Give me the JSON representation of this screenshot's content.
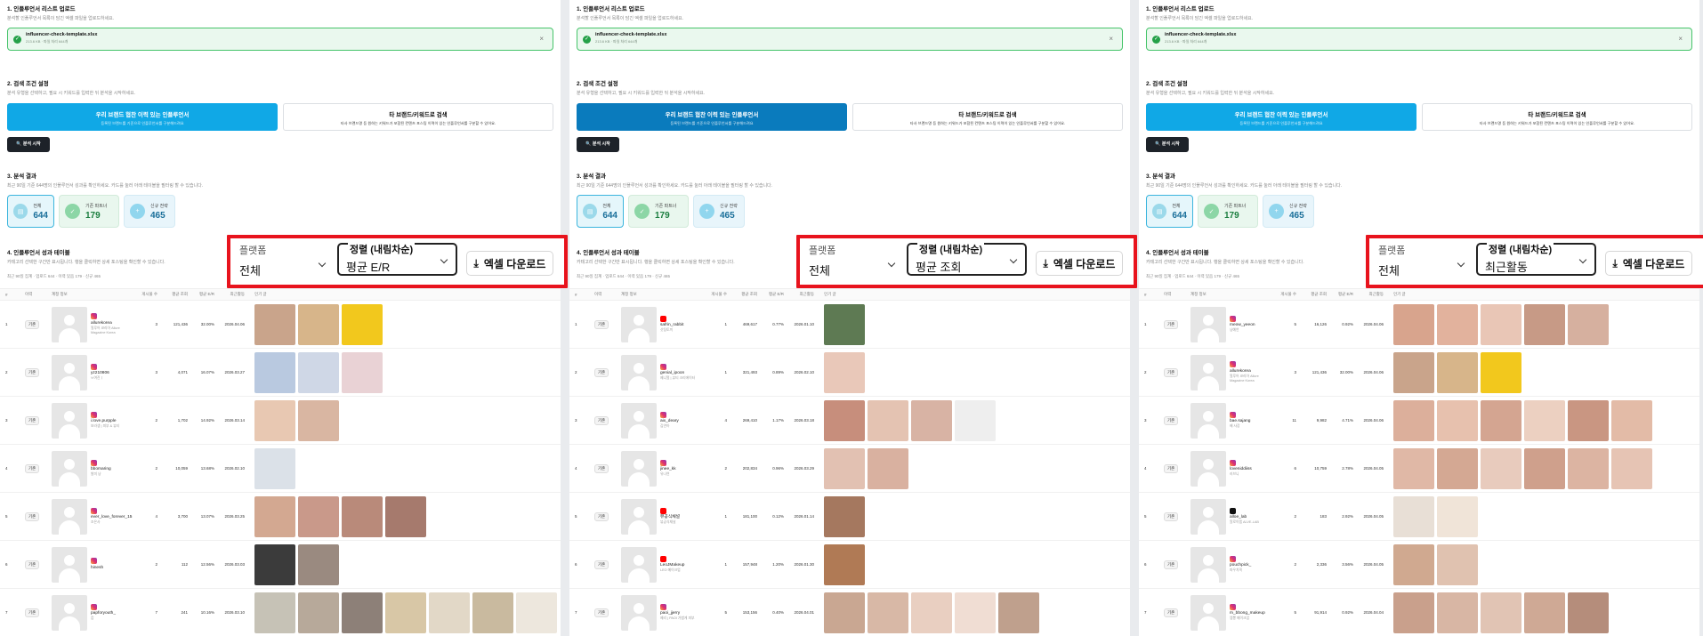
{
  "colors": {
    "accent": "#10a8e6",
    "highlight": "#e8131d",
    "success": "#24a148"
  },
  "panels": [
    {
      "s1": {
        "title": "1. 인플루언서 리스트 업로드",
        "desc": "분석할 인플루언서 목록이 담긴 엑셀 파일을 업로드하세요.",
        "file": "influencer-check-template.xlsx",
        "fileinfo": "213.6 KB · 파일 처리 644개"
      },
      "s2": {
        "title": "2. 검색 조건 설정",
        "desc": "분석 유형을 선택하고, 필요 시 키워드를 입력한 뒤 분석을 시작하세요.",
        "opt1": "우리 브랜드 협찬 이력 있는 인플루언서",
        "opt1s": "등록된 브랜드를 기준으로 인플루언서를 구분해드려요",
        "opt2": "타 브랜드/키워드로 검색",
        "opt2s": "타사 브랜드명 등 원하는 키워드가 포함된 컨텐츠 포스팅 이력이 있는 인플루언서를 구분할 수 있어요.",
        "run": "분석 시작"
      },
      "s3": {
        "title": "3. 분석 결과",
        "desc": "최근 90일 기준 644명의 인플루언서 성과를 확인하세요. 카드를 눌러 아래 테이블을 필터링 할 수 있습니다.",
        "all_label": "전체",
        "all": "644",
        "ex_label": "기존 파트너",
        "ex": "179",
        "new_label": "신규 전략",
        "new": "465"
      },
      "s4": {
        "title": "4. 인플루언서 성과 테이블",
        "desc": "카테고리 선택한 구간만 표시됩니다. 행을 클릭하면 상세 포스팅을 확인할 수 있습니다.",
        "meta": "최근 90일 집계 · 업로드 644 · 이력 있음 179 · 신규 465",
        "platform_label": "플랫폼",
        "platform": "전체",
        "sort_label": "정렬 (내림차순)",
        "sort": "평균 E/R",
        "download": "엑셀 다운로드"
      },
      "headers": [
        "#",
        "이력",
        "계정 정보",
        "게시물 수",
        "평균 조회",
        "평균 E/R",
        "최근활동",
        "인기 글"
      ],
      "rows": [
        {
          "no": "1",
          "tag": "기존",
          "pf": "ig",
          "name": "allurekorea",
          "sub": "얼루어 코리아 Allure Magazine Korea",
          "n": "3",
          "v": "121,436",
          "e": "32.00%",
          "d": "2026.04.06",
          "thumbs": [
            "#c9a48b",
            "#d7b58a",
            "#f2c81d"
          ]
        },
        {
          "no": "2",
          "tag": "기존",
          "pf": "ig",
          "name": "yz210806",
          "sub": "ㅂ여진ㅣ",
          "n": "3",
          "v": "4,071",
          "e": "16.07%",
          "d": "2026.03.27",
          "thumbs": [
            "#b9c9e0",
            "#cfd7e6",
            "#e9d2d5"
          ]
        },
        {
          "no": "3",
          "tag": "기존",
          "pf": "ig",
          "name": "i.love.purpple",
          "sub": "보라생 | 피부 & 뷰티",
          "n": "2",
          "v": "1,702",
          "e": "14.92%",
          "d": "2026.03.14",
          "thumbs": [
            "#e8c8b2",
            "#d9b6a2"
          ]
        },
        {
          "no": "4",
          "tag": "기존",
          "pf": "ig",
          "name": "bbomaring",
          "sub": "발미 냥",
          "n": "2",
          "v": "10,059",
          "e": "13.68%",
          "d": "2026.02.10",
          "thumbs": [
            "#dbe1e8"
          ]
        },
        {
          "no": "5",
          "tag": "기존",
          "pf": "ig",
          "name": "ever_love_forever_15",
          "sub": "조은사",
          "n": "4",
          "v": "3,700",
          "e": "13.07%",
          "d": "2026.03.25",
          "thumbs": [
            "#d3a891",
            "#c9998a",
            "#b98a7a",
            "#a67a6d"
          ]
        },
        {
          "no": "6",
          "tag": "기존",
          "pf": "ig",
          "name": "hinesh",
          "sub": "",
          "n": "2",
          "v": "112",
          "e": "12.56%",
          "d": "2026.03.03",
          "thumbs": [
            "#3b3b3b",
            "#9a8a80"
          ]
        },
        {
          "no": "7",
          "tag": "기존",
          "pf": "ig",
          "name": "papforyouth_",
          "sub": "캄",
          "n": "7",
          "v": "241",
          "e": "10.16%",
          "d": "2026.03.10",
          "thumbs": [
            "#c6c2b6",
            "#b7a99a",
            "#8d8078",
            "#d8c7a6",
            "#e2d8c7",
            "#c9ba9f",
            "#ede7dd"
          ]
        }
      ]
    },
    {
      "s1": {
        "title": "1. 인플루언서 리스트 업로드",
        "desc": "분석할 인플루언서 목록이 담긴 엑셀 파일을 업로드하세요.",
        "file": "influencer-check-template.xlsx",
        "fileinfo": "213.6 KB · 파일 처리 644개"
      },
      "s2": {
        "title": "2. 검색 조건 설정",
        "desc": "분석 유형을 선택하고, 필요 시 키워드를 입력한 뒤 분석을 시작하세요.",
        "opt1": "우리 브랜드 협찬 이력 있는 인플루언서",
        "opt1s": "등록된 브랜드를 기준으로 인플루언서를 구분해드려요",
        "opt2": "타 브랜드/키워드로 검색",
        "opt2s": "타사 브랜드명 등 원하는 키워드가 포함된 컨텐츠 포스팅 이력이 있는 인플루언서를 구분할 수 있어요.",
        "run": "분석 시작"
      },
      "s3": {
        "title": "3. 분석 결과",
        "desc": "최근 90일 기준 644명의 인플루언서 성과를 확인하세요. 카드를 눌러 아래 테이블을 필터링 할 수 있습니다.",
        "all_label": "전체",
        "all": "644",
        "ex_label": "기존 파트너",
        "ex": "179",
        "new_label": "신규 전략",
        "new": "465"
      },
      "s4": {
        "title": "4. 인플루언서 성과 테이블",
        "desc": "카테고리 선택한 구간만 표시됩니다. 행을 클릭하면 상세 포스팅을 확인할 수 있습니다.",
        "meta": "최근 90일 집계 · 업로드 644 · 이력 있음 179 · 신규 465",
        "platform_label": "플랫폼",
        "platform": "전체",
        "sort_label": "정렬 (내림차순)",
        "sort": "평균 조회",
        "download": "엑셀 다운로드"
      },
      "headers": [
        "#",
        "이력",
        "계정 정보",
        "게시물 수",
        "평균 조회",
        "평균 E/R",
        "최근활동",
        "인기 글"
      ],
      "rows": [
        {
          "no": "1",
          "tag": "기존",
          "pf": "yt",
          "name": "safrin_rabbit",
          "sub": "삿팅토끼",
          "n": "1",
          "v": "469,617",
          "e": "0.77%",
          "d": "2026.01.10",
          "thumbs": [
            "#5e7a53"
          ]
        },
        {
          "no": "2",
          "tag": "기존",
          "pf": "ig",
          "name": "genial_ipoon",
          "sub": "제니얼 | 뷰티 크리에이터",
          "n": "1",
          "v": "321,493",
          "e": "0.89%",
          "d": "2026.02.10",
          "thumbs": [
            "#e9c8b9"
          ]
        },
        {
          "no": "3",
          "tag": "기존",
          "pf": "ig",
          "name": "aix_deary",
          "sub": "김연아",
          "n": "4",
          "v": "269,410",
          "e": "1.17%",
          "d": "2026.03.18",
          "thumbs": [
            "#c78e7c",
            "#e4c3b2",
            "#d8b3a4",
            "#eeeeee"
          ]
        },
        {
          "no": "4",
          "tag": "기존",
          "pf": "ig",
          "name": "jinee_kk",
          "sub": "유나연",
          "n": "2",
          "v": "202,834",
          "e": "0.96%",
          "d": "2026.03.29",
          "thumbs": [
            "#e2c1b2",
            "#d9b1a0"
          ]
        },
        {
          "no": "5",
          "tag": "기존",
          "pf": "yt",
          "name": "뷰공식채널",
          "sub": "뷰공식채널",
          "n": "1",
          "v": "181,100",
          "e": "0.12%",
          "d": "2026.01.14",
          "thumbs": [
            "#a5785f"
          ]
        },
        {
          "no": "6",
          "tag": "기존",
          "pf": "yt",
          "name": "LeoJMakeup",
          "sub": "LEO 메이크업",
          "n": "1",
          "v": "157,948",
          "e": "1.20%",
          "d": "2026.01.30",
          "thumbs": [
            "#b07a55"
          ]
        },
        {
          "no": "7",
          "tag": "기존",
          "pf": "ig",
          "name": "paoi_jjerry",
          "sub": "제리 | PAOI 가볍게 피부",
          "n": "5",
          "v": "153,156",
          "e": "0.40%",
          "d": "2026.04.01",
          "thumbs": [
            "#c9a792",
            "#d8b8a6",
            "#e9cfc1",
            "#f0ddd3",
            "#bfa08d"
          ]
        }
      ]
    },
    {
      "s1": {
        "title": "1. 인플루언서 리스트 업로드",
        "desc": "분석할 인플루언서 목록이 담긴 엑셀 파일을 업로드하세요.",
        "file": "influencer-check-template.xlsx",
        "fileinfo": "213.6 KB · 파일 처리 644개"
      },
      "s2": {
        "title": "2. 검색 조건 설정",
        "desc": "분석 유형을 선택하고, 필요 시 키워드를 입력한 뒤 분석을 시작하세요.",
        "opt1": "우리 브랜드 협찬 이력 있는 인플루언서",
        "opt1s": "등록된 브랜드를 기준으로 인플루언서를 구분해드려요",
        "opt2": "타 브랜드/키워드로 검색",
        "opt2s": "타사 브랜드명 등 원하는 키워드가 포함된 컨텐츠 포스팅 이력이 있는 인플루언서를 구분할 수 있어요.",
        "run": "분석 시작"
      },
      "s3": {
        "title": "3. 분석 결과",
        "desc": "최근 90일 기준 644명의 인플루언서 성과를 확인하세요. 카드를 눌러 아래 테이블을 필터링 할 수 있습니다.",
        "all_label": "전체",
        "all": "644",
        "ex_label": "기존 파트너",
        "ex": "179",
        "new_label": "신규 전략",
        "new": "465"
      },
      "s4": {
        "title": "4. 인플루언서 성과 테이블",
        "desc": "카테고리 선택한 구간만 표시됩니다. 행을 클릭하면 상세 포스팅을 확인할 수 있습니다.",
        "meta": "최근 90일 집계 · 업로드 644 · 이력 있음 179 · 신규 465",
        "platform_label": "플랫폼",
        "platform": "전체",
        "sort_label": "정렬 (내림차순)",
        "sort": "최근활동",
        "download": "엑셀 다운로드"
      },
      "headers": [
        "#",
        "이력",
        "계정 정보",
        "게시물 수",
        "평균 조회",
        "평균 E/R",
        "최근활동",
        "인기 글"
      ],
      "rows": [
        {
          "no": "1",
          "tag": "기존",
          "pf": "ig",
          "name": "meow_yeeon",
          "sub": "냥예언",
          "n": "5",
          "v": "16,126",
          "e": "0.92%",
          "d": "2026.04.06",
          "thumbs": [
            "#d8a48d",
            "#e2b29d",
            "#e9c6b6",
            "#c79a86",
            "#d6b09f"
          ]
        },
        {
          "no": "2",
          "tag": "기존",
          "pf": "ig",
          "name": "allurekorea",
          "sub": "얼루어 코리아 Allure Magazine Korea",
          "n": "3",
          "v": "121,436",
          "e": "32.00%",
          "d": "2026.04.06",
          "thumbs": [
            "#c9a48b",
            "#d7b58a",
            "#f2c81d"
          ]
        },
        {
          "no": "3",
          "tag": "기존",
          "pf": "ig",
          "name": "bae.sajang",
          "sub": "배 사장",
          "n": "11",
          "v": "9,982",
          "e": "4.71%",
          "d": "2026.04.06",
          "thumbs": [
            "#dcaf9b",
            "#e7c1ae",
            "#d4a591",
            "#ecd0c1",
            "#c99682",
            "#e3bba7"
          ]
        },
        {
          "no": "4",
          "tag": "기존",
          "pf": "ig",
          "name": "loveniddiiss",
          "sub": "러브니",
          "n": "6",
          "v": "10,759",
          "e": "2.78%",
          "d": "2026.04.05",
          "thumbs": [
            "#e0b8a6",
            "#d4a893",
            "#e8cbbd",
            "#cfa08c",
            "#dcb4a2",
            "#e6c4b4"
          ]
        },
        {
          "no": "5",
          "tag": "기존",
          "pf": "tt",
          "name": "alloe_lab",
          "sub": "알로이랩 ALVE-LAB",
          "n": "2",
          "v": "183",
          "e": "2.92%",
          "d": "2026.04.05",
          "thumbs": [
            "#e8dfd6",
            "#f0e4d8"
          ]
        },
        {
          "no": "6",
          "tag": "기존",
          "pf": "ig",
          "name": "pouchpick_",
          "sub": "파우치픽",
          "n": "2",
          "v": "2,336",
          "e": "3.56%",
          "d": "2026.04.05",
          "thumbs": [
            "#d0a990",
            "#e0c2b0"
          ]
        },
        {
          "no": "7",
          "tag": "기존",
          "pf": "ig",
          "name": "m_bbong_makeup",
          "sub": "엠뽕 메이크업",
          "n": "5",
          "v": "91,914",
          "e": "0.92%",
          "d": "2026.04.04",
          "thumbs": [
            "#c9a08c",
            "#d8b6a4",
            "#e1c4b4",
            "#cfa995",
            "#b58d7b"
          ]
        }
      ]
    }
  ]
}
